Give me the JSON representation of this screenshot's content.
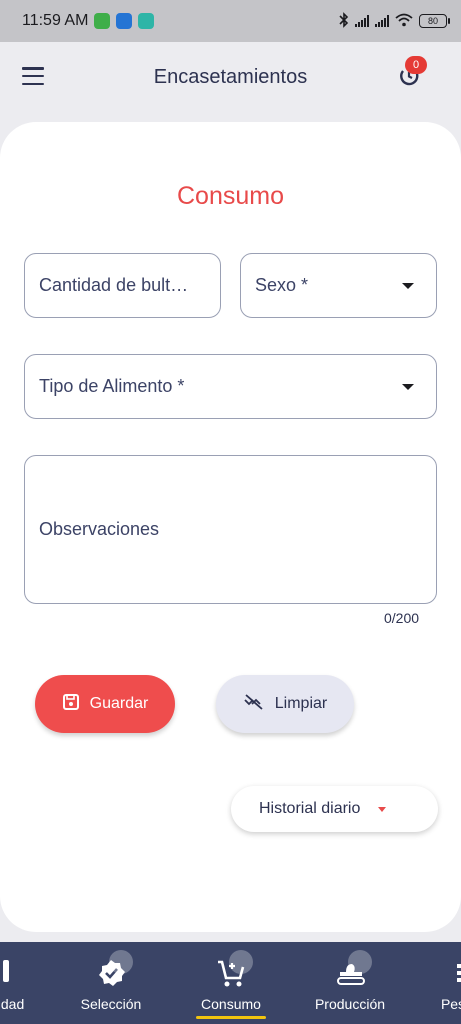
{
  "status_bar": {
    "time": "11:59 AM",
    "battery": "80",
    "icons": [
      "whatsapp-icon",
      "outlook-icon",
      "app-icon",
      "bluetooth-icon",
      "signal-icon",
      "signal-icon",
      "wifi-icon",
      "battery-icon"
    ]
  },
  "app_bar": {
    "title": "Encasetamientos",
    "menu_icon": "hamburger-menu-icon",
    "history_icon": "history-icon",
    "badge_count": "0"
  },
  "form": {
    "title": "Consumo",
    "quantity_placeholder": "Cantidad de bult…",
    "sex_label": "Sexo *",
    "food_type_label": "Tipo de Alimento *",
    "observations_placeholder": "Observaciones",
    "counter": "0/200",
    "save_label": "Guardar",
    "clear_label": "Limpiar",
    "history_dropdown": "Historial diario"
  },
  "bottom_nav": {
    "items": [
      {
        "label": "idad",
        "icon": "partial-icon"
      },
      {
        "label": "Selección",
        "icon": "verified-badge-icon"
      },
      {
        "label": "Consumo",
        "icon": "cart-icon"
      },
      {
        "label": "Producción",
        "icon": "conveyor-icon"
      },
      {
        "label": "Pes",
        "icon": "scale-icon"
      }
    ],
    "active": "Consumo"
  },
  "colors": {
    "accent": "#e84a4a",
    "nav_bg": "#3a4466",
    "nav_indicator": "#f1c40f",
    "text": "#2d3250"
  }
}
